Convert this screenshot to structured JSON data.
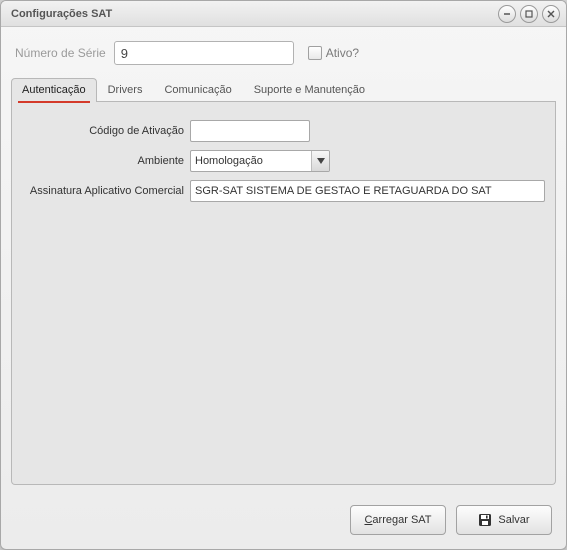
{
  "window": {
    "title": "Configurações SAT"
  },
  "top": {
    "serial_label": "Número de Série",
    "serial_value": "9",
    "active_label": "Ativo?"
  },
  "tabs": {
    "items": [
      {
        "label": "Autenticação"
      },
      {
        "label": "Drivers"
      },
      {
        "label": "Comunicação"
      },
      {
        "label": "Suporte e Manutenção"
      }
    ]
  },
  "form": {
    "ativacao_label": "Código de Ativação",
    "ativacao_value": "",
    "ambiente_label": "Ambiente",
    "ambiente_value": "Homologação",
    "assinatura_label": "Assinatura Aplicativo Comercial",
    "assinatura_value": "SGR-SAT SISTEMA DE GESTAO E RETAGUARDA DO SAT"
  },
  "buttons": {
    "carregar": "Carregar SAT",
    "salvar": "Salvar"
  }
}
